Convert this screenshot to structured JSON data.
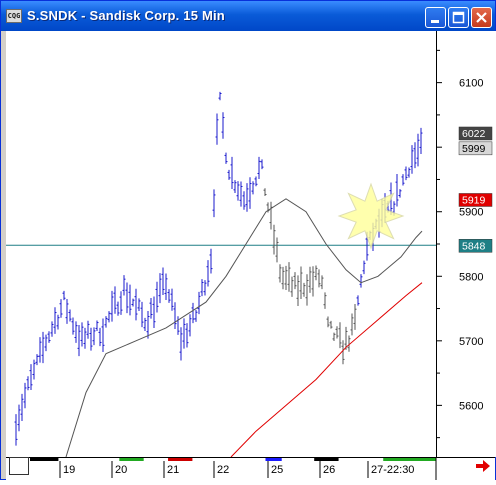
{
  "window": {
    "title": "S.SNDK - Sandisk Corp. 15 Min",
    "app_icon_text": "CQG",
    "buttons": [
      "minimize",
      "maximize",
      "close"
    ]
  },
  "chart_data": {
    "type": "ohlc-bar",
    "symbol": "S.SNDK",
    "interval": "15 Min",
    "y_axis_ticks": [
      6100,
      6000,
      5900,
      5800,
      5700,
      5600
    ],
    "y_range": [
      5520,
      6180
    ],
    "time_labels": [
      "19",
      "20",
      "21",
      "22",
      "25",
      "26",
      "27-22:30"
    ],
    "price_flags": [
      {
        "label": "6022",
        "value": 6022,
        "style": "dark"
      },
      {
        "label": "5999",
        "value": 5999,
        "style": "light"
      },
      {
        "label": "5919",
        "value": 5919,
        "style": "red"
      },
      {
        "label": "5848",
        "value": 5848,
        "style": "teal"
      }
    ],
    "horizontal_line": {
      "value": 5848,
      "color": "#1e7f86"
    },
    "session_segments": [
      {
        "color": "#000000",
        "start": 0,
        "end": 0.07
      },
      {
        "color": "#22aa22",
        "start": 0.22,
        "end": 0.28
      },
      {
        "color": "#cc0000",
        "start": 0.34,
        "end": 0.4
      },
      {
        "color": "#1a1aff",
        "start": 0.58,
        "end": 0.62
      },
      {
        "color": "#000000",
        "start": 0.7,
        "end": 0.76
      },
      {
        "color": "#22aa22",
        "start": 0.87,
        "end": 1.0
      }
    ],
    "highlight_marker": {
      "shape": "starburst",
      "color": "#ffff99"
    },
    "moving_averages": [
      {
        "color": "#555555"
      },
      {
        "color": "#e00000"
      }
    ]
  }
}
